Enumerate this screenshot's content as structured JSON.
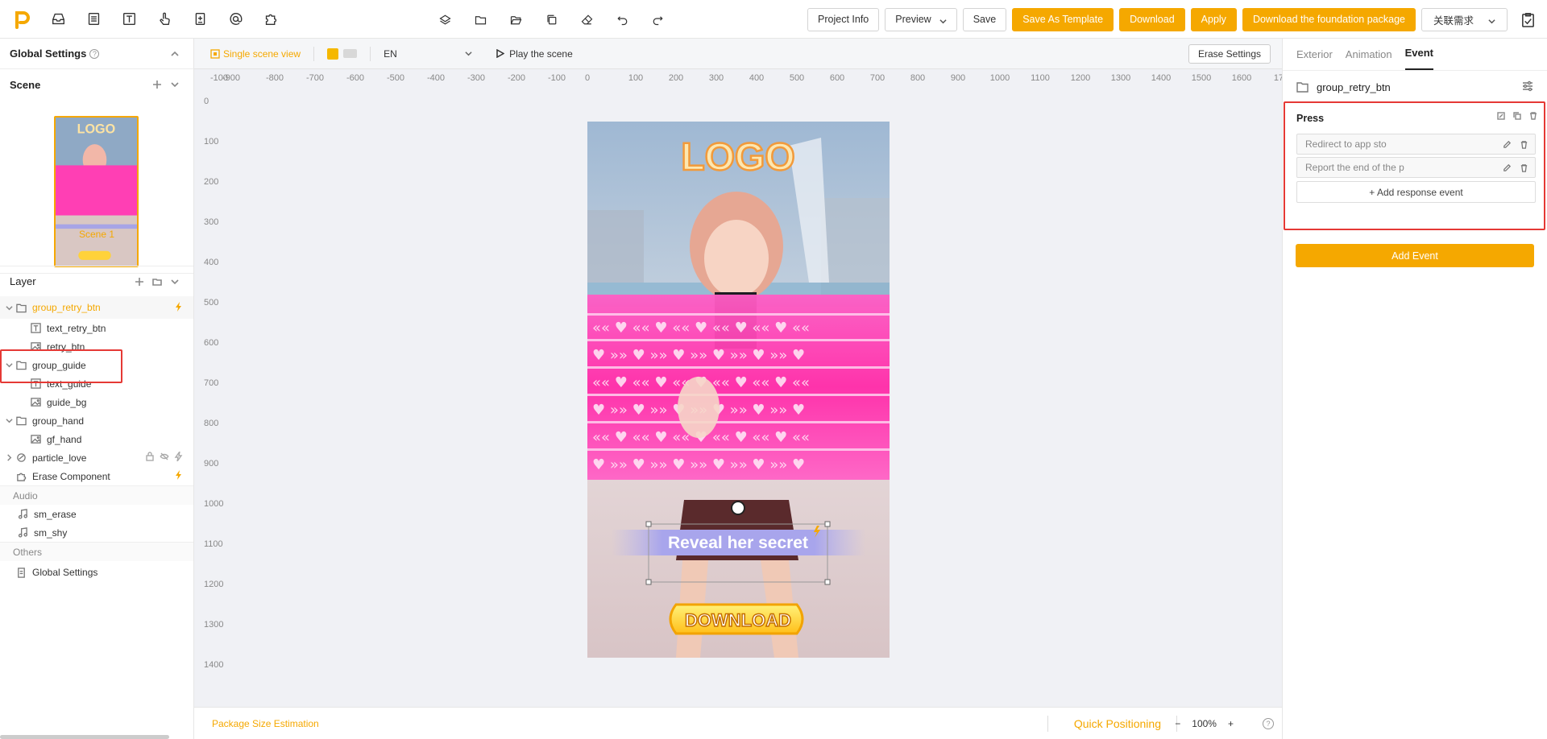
{
  "toolbar": {
    "left_icons": [
      "inbox-icon",
      "list-icon",
      "text-icon",
      "hand-pointer-icon",
      "file-icon",
      "at-icon",
      "puzzle-icon"
    ],
    "center_icons": [
      "layers-icon",
      "folder-icon",
      "open-folder-icon",
      "copy-icon",
      "eraser-icon",
      "undo-icon",
      "redo-icon"
    ],
    "project_info": "Project Info",
    "preview": "Preview",
    "save": "Save",
    "save_template": "Save As Template",
    "download": "Download",
    "apply": "Apply",
    "download_foundation": "Download the foundation package",
    "related_demand": "关联需求"
  },
  "left": {
    "global_settings": "Global Settings",
    "scene_title": "Scene",
    "scene_name": "Scene 1",
    "layer_title": "Layer",
    "layers": [
      {
        "name": "group_retry_btn",
        "type": "group",
        "depth": 0,
        "selected": true,
        "bolt": true
      },
      {
        "name": "text_retry_btn",
        "type": "text",
        "depth": 1
      },
      {
        "name": "retry_btn",
        "type": "image",
        "depth": 1
      },
      {
        "name": "group_guide",
        "type": "group",
        "depth": 0
      },
      {
        "name": "text_guide",
        "type": "text",
        "depth": 1
      },
      {
        "name": "guide_bg",
        "type": "image",
        "depth": 1
      },
      {
        "name": "group_hand",
        "type": "group",
        "depth": 0
      },
      {
        "name": "gf_hand",
        "type": "image",
        "depth": 1
      },
      {
        "name": "particle_love",
        "type": "particle",
        "depth": 0,
        "bolt": true,
        "lock": true
      },
      {
        "name": "Erase Component",
        "type": "component",
        "depth": 0,
        "bolt": true
      }
    ],
    "audio_title": "Audio",
    "audio": [
      "sm_erase",
      "sm_shy"
    ],
    "others_title": "Others",
    "others": [
      "Global Settings"
    ]
  },
  "canvas": {
    "single_scene_view": "Single scene view",
    "language": "EN",
    "play": "Play the scene",
    "erase_settings": "Erase Settings",
    "h_ticks": [
      "-100",
      "-900",
      "-800",
      "-700",
      "-600",
      "-500",
      "-400",
      "-300",
      "-200",
      "-100",
      "0",
      "100",
      "200",
      "300",
      "400",
      "500",
      "600",
      "700",
      "800",
      "900",
      "1000",
      "1100",
      "1200",
      "1300",
      "1400",
      "1500",
      "1600",
      "17"
    ],
    "v_ticks": [
      "0",
      "100",
      "200",
      "300",
      "400",
      "500",
      "600",
      "700",
      "800",
      "900",
      "1000",
      "1100",
      "1200",
      "1300",
      "1400"
    ],
    "stage": {
      "logo_text": "LOGO",
      "reveal_text": "Reveal her secret",
      "download_text": "DOWNLOAD"
    },
    "package_size": "Package Size Estimation",
    "quick_positioning": "Quick Positioning",
    "zoom": "100%"
  },
  "right": {
    "tabs": [
      "Exterior",
      "Animation",
      "Event"
    ],
    "active_tab": "Event",
    "group_name": "group_retry_btn",
    "event_name": "Press",
    "responses": [
      "Redirect to app sto",
      "Report the end of the p"
    ],
    "add_response": "+ Add response event",
    "add_event": "Add Event"
  },
  "colors": {
    "accent": "#f5a800",
    "highlight": "#e53935",
    "pink": "#ff3fb4"
  }
}
